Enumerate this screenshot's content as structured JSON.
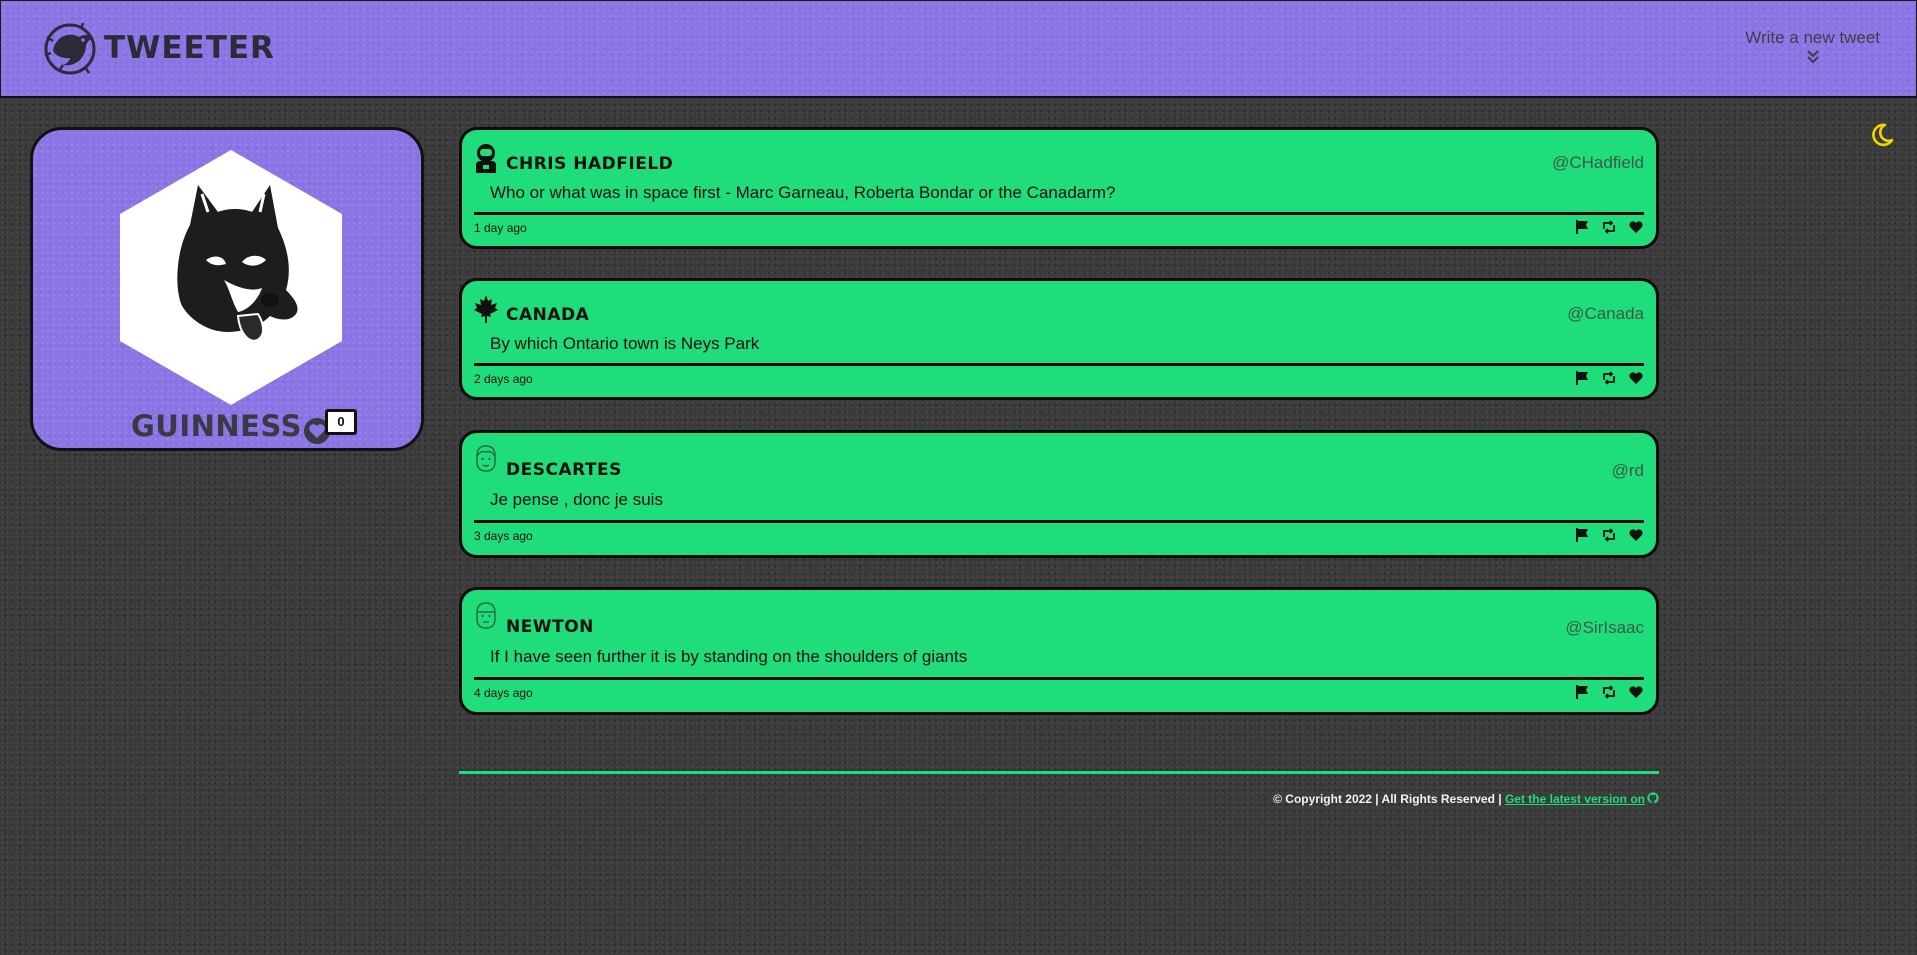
{
  "header": {
    "brand": "Tweeter",
    "compose_label": "Write  a new tweet"
  },
  "profile": {
    "name": "Guinness",
    "like_count": "0"
  },
  "tweets": [
    {
      "name": "Chris Hadfield",
      "handle": "@CHadfield",
      "content": "Who or what was in space first - Marc Garneau, Roberta Bondar or the Canadarm?",
      "time": "1 day ago",
      "avatar_icon": "astronaut-icon"
    },
    {
      "name": "Canada",
      "handle": "@Canada",
      "content": "By which Ontario town is Neys Park",
      "time": "2 days ago",
      "avatar_icon": "maple-leaf-icon"
    },
    {
      "name": "Descartes",
      "handle": "@rd",
      "content": "Je pense , donc je suis",
      "time": "3 days ago",
      "avatar_icon": "face-outline-icon"
    },
    {
      "name": "Newton",
      "handle": "@SirIsaac",
      "content": "If I have seen further it is by standing on the shoulders of giants",
      "time": "4 days ago",
      "avatar_icon": "face-outline-icon"
    }
  ],
  "footer": {
    "copyright": "© Copyright 2022 | All Rights Reserved | ",
    "link": "Get the latest version on"
  },
  "colors": {
    "accent_green": "#1edd7a",
    "header_purple": "#8c74e4",
    "moon_yellow": "#f5d400",
    "background": "#3b3b3b"
  },
  "icons": [
    "bird-logo-icon",
    "chevron-double-down-icon",
    "moon-icon",
    "heart-icon",
    "flag-icon",
    "retweet-icon",
    "github-icon",
    "husky-avatar"
  ]
}
